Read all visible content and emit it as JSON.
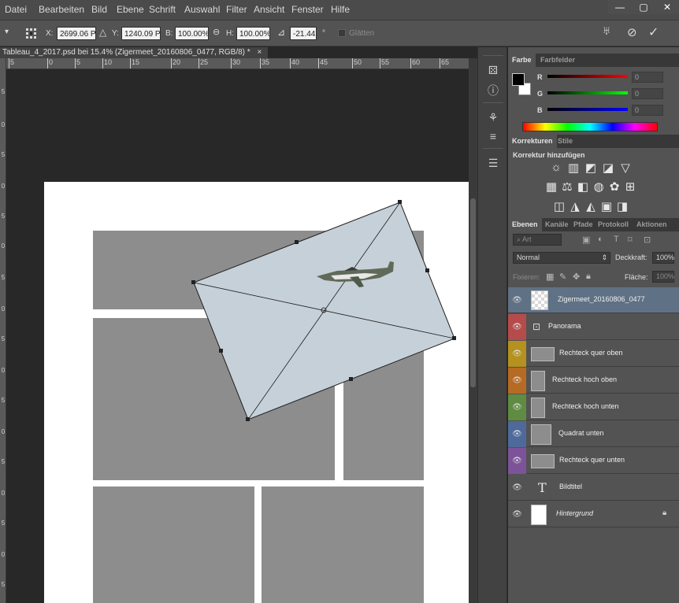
{
  "menu": {
    "items": [
      "Datei",
      "Bearbeiten",
      "Bild",
      "Ebene",
      "Schrift",
      "Auswahl",
      "Filter",
      "Ansicht",
      "Fenster",
      "Hilfe"
    ]
  },
  "window_controls": {
    "minimize": "—",
    "maximize": "▢",
    "close": "✕"
  },
  "options_bar": {
    "x_label": "X:",
    "x_value": "2699.06 P:",
    "y_label": "Y:",
    "y_value": "1240.09 P:",
    "w_label": "B:",
    "w_value": "100.00%",
    "h_label": "H:",
    "h_value": "100.00%",
    "angle_value": "-21.44",
    "angle_unit": "°",
    "smooth_label": "Glätten"
  },
  "document": {
    "tab_title": "Tableau_4_2017.psd bei 15.4% (Zigermeet_20160806_0477, RGB/8) *",
    "tab_close": "×",
    "ruler_h": [
      "5",
      "0",
      "5",
      "10",
      "15",
      "20",
      "25",
      "30",
      "35",
      "40",
      "45",
      "50",
      "55",
      "60",
      "65"
    ],
    "ruler_v": [
      "0",
      "5",
      "0",
      "5",
      "0",
      "5",
      "0",
      "5",
      "0",
      "5",
      "0",
      "5",
      "0",
      "5",
      "0",
      "5",
      "0",
      "5",
      "0"
    ]
  },
  "color_panel": {
    "tabs": [
      "Farbe",
      "Farbfelder"
    ],
    "r_label": "R",
    "g_label": "G",
    "b_label": "B",
    "r_value": "0",
    "g_value": "0",
    "b_value": "0",
    "foreground": "#000000",
    "background": "#ffffff"
  },
  "adjustments_panel": {
    "tabs": [
      "Korrekturen",
      "Stile"
    ],
    "heading": "Korrektur hinzufügen"
  },
  "layers_panel": {
    "tabs": [
      "Ebenen",
      "Kanäle",
      "Pfade",
      "Protokoll",
      "Aktionen"
    ],
    "filter_label": "Art",
    "blend_mode": "Normal",
    "opacity_label": "Deckkraft:",
    "opacity_value": "100%",
    "lock_label": "Fixieren:",
    "fill_label": "Fläche:",
    "fill_value": "100%",
    "layers": [
      {
        "name": "Zigermeet_20160806_0477",
        "color": "#535353",
        "selected": true
      },
      {
        "name": "Panorama",
        "color": "#b64b4b",
        "selected": false
      },
      {
        "name": "Rechteck quer oben",
        "color": "#b5911f",
        "selected": false
      },
      {
        "name": "Rechteck hoch oben",
        "color": "#b66b24",
        "selected": false
      },
      {
        "name": "Rechteck hoch unten",
        "color": "#5f8b43",
        "selected": false
      },
      {
        "name": "Quadrat unten",
        "color": "#4e6a9a",
        "selected": false
      },
      {
        "name": "Rechteck quer unten",
        "color": "#7c5398",
        "selected": false
      },
      {
        "name": "Bildtitel",
        "color": "#535353",
        "selected": false
      },
      {
        "name": "Hintergrund",
        "color": "#535353",
        "selected": false
      }
    ]
  }
}
